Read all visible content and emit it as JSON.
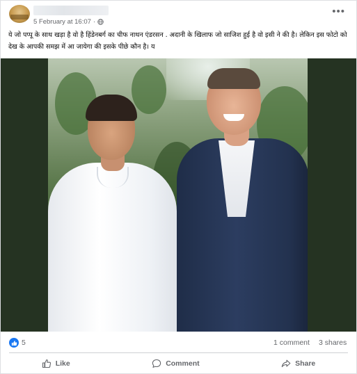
{
  "post": {
    "timestamp": "5 February at 16:07",
    "separator": "·",
    "text": "ये जो पप्पू के साथ खड़ा है  वो है हिंडेनबर्ग का चीफ नाथन एंडरसन . अदानी के खिलाफ जो साजिश हुई है वो इसी ने की है। लेकिन इस फोटो को देख के आपकी समझ में आ जायेगा की इसके पीछे कौन है। य",
    "more_icon": "ellipsis-icon",
    "audience_icon": "globe-icon"
  },
  "stats": {
    "reaction_icon": "thumbs-up-icon",
    "reactions": "5",
    "comments": "1 comment",
    "shares": "3 shares"
  },
  "actions": {
    "like": "Like",
    "comment": "Comment",
    "share": "Share"
  },
  "colors": {
    "accent": "#1877f2",
    "secondary_text": "#65676b",
    "divider": "#ced0d4"
  }
}
